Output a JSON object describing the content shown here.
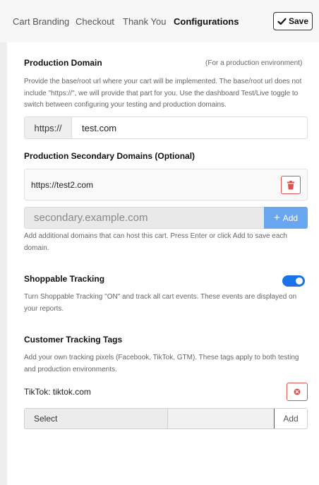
{
  "tabs": [
    {
      "label": "Cart Branding"
    },
    {
      "label": "Checkout"
    },
    {
      "label": "Thank You"
    },
    {
      "label": "Configurations"
    }
  ],
  "toolbar": {
    "save_label": "Save"
  },
  "production_domain": {
    "title": "Production Domain",
    "hint": "(For a production environment)",
    "description": "Provide the base/root url where your cart will be implemented. The base/root url does not include \"https://\", we will provide that part for you. Use the dashboard Test/Live toggle to switch between configuring your testing and production domains.",
    "prefix": "https://",
    "value": "test.com"
  },
  "secondary_domains": {
    "title": "Production Secondary Domains (Optional)",
    "items": [
      {
        "url": "https://test2.com"
      }
    ],
    "placeholder": "secondary.example.com",
    "add_label": "Add",
    "description": "Add additional domains that can host this cart. Press Enter or click Add to save each domain."
  },
  "shoppable_tracking": {
    "title": "Shoppable Tracking",
    "enabled": true,
    "description": "Turn Shoppable Tracking \"ON\" and track all cart events. These events are displayed on your reports."
  },
  "customer_tags": {
    "title": "Customer Tracking Tags",
    "description": "Add your own tracking pixels (Facebook, TikTok, GTM). These tags apply to both testing and production environments.",
    "items": [
      {
        "label": "TikTok: tiktok.com"
      }
    ],
    "select_label": "Select",
    "add_label": "Add"
  },
  "colors": {
    "accent": "#1a73e8",
    "add_button": "#6aa6f0",
    "danger": "#d9534f"
  }
}
